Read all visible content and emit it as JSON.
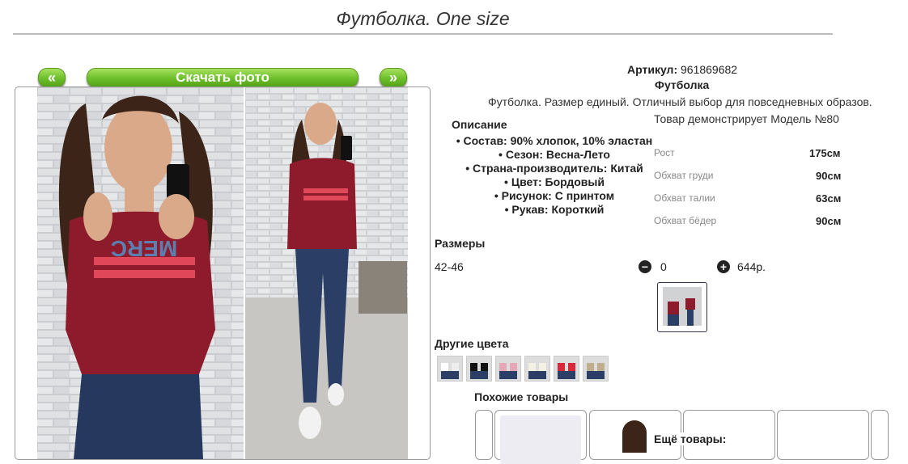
{
  "product": {
    "title": "Футболка. One size",
    "article_label": "Артикул:",
    "article_value": "961869682",
    "name": "Футболка",
    "short_desc": "Футболка. Размер единый. Отличный выбор для повседневных образов.",
    "model_note": "Товар демонстрирует Модель №80"
  },
  "gallery": {
    "prev_label": "«",
    "next_label": "»",
    "download_label": "Скачать фото"
  },
  "description": {
    "heading": "Описание",
    "bullets": [
      "Состав: 90% хлопок, 10% эластан",
      "Сезон: Весна-Лето",
      "Страна-производитель: Китай",
      "Цвет: Бордовый",
      "Рисунок: С принтом",
      "Рукав: Короткий"
    ]
  },
  "model_specs": [
    {
      "name": "Рост",
      "value": "175см"
    },
    {
      "name": "Обхват груди",
      "value": "90см"
    },
    {
      "name": "Обхват талии",
      "value": "63см"
    },
    {
      "name": "Обхват бёдер",
      "value": "90см"
    }
  ],
  "sizes": {
    "heading": "Размеры",
    "size": "42-46",
    "minus_icon": "minus-circle-icon",
    "plus_icon": "plus-circle-icon",
    "quantity": "0",
    "price": "644р."
  },
  "other_colors": {
    "heading": "Другие цвета"
  },
  "similar": {
    "heading": "Похожие товары",
    "more_label": "Ещё товары:"
  },
  "colors": {
    "button_green": "#6cbf2a",
    "shirt": "#8e1b2c"
  }
}
